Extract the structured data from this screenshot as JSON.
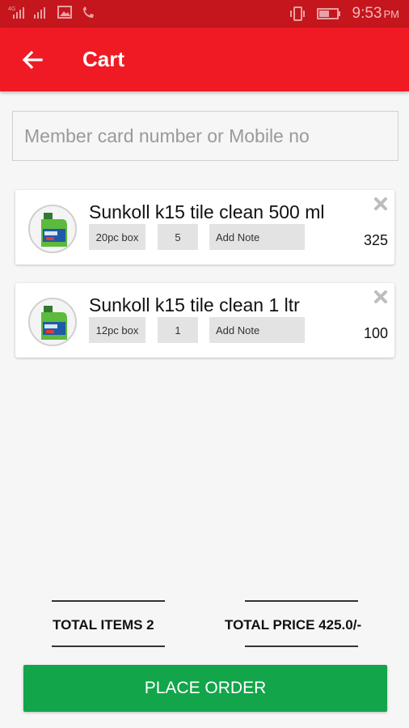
{
  "status_bar": {
    "time": "9:53",
    "ampm": "PM",
    "network_label": "4G"
  },
  "app_bar": {
    "title": "Cart",
    "back_icon": "arrow-left-icon"
  },
  "search": {
    "placeholder": "Member card number or Mobile no",
    "value": ""
  },
  "cart": {
    "items": [
      {
        "name": "Sunkoll k15 tile clean 500 ml",
        "pack": "20pc box",
        "quantity": "5",
        "note_label": "Add Note",
        "price": "325"
      },
      {
        "name": "Sunkoll k15 tile clean 1 ltr",
        "pack": "12pc box",
        "quantity": "1",
        "note_label": "Add Note",
        "price": "100"
      }
    ]
  },
  "summary": {
    "total_items": "TOTAL ITEMS 2",
    "total_price": "TOTAL PRICE 425.0/-"
  },
  "actions": {
    "place_order": "PLACE ORDER"
  },
  "colors": {
    "status_bar": "#c4161c",
    "app_bar": "#f01a24",
    "order_button": "#12a54a"
  }
}
